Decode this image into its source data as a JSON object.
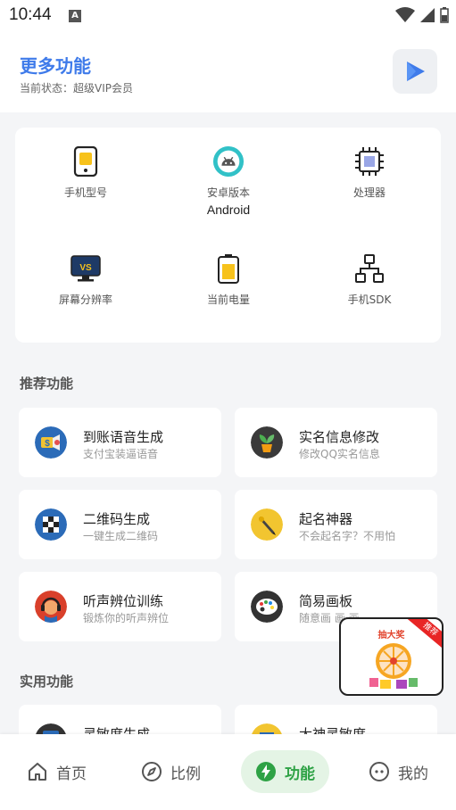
{
  "status_bar": {
    "time": "10:44",
    "notif_icon": "A"
  },
  "header": {
    "title": "更多功能",
    "subtitle": "当前状态：超级VIP会员"
  },
  "device_info": [
    {
      "label": "手机型号",
      "value": "",
      "icon": "phone-icon"
    },
    {
      "label": "安卓版本",
      "value": "Android",
      "icon": "android-icon"
    },
    {
      "label": "处理器",
      "value": "",
      "icon": "cpu-icon"
    },
    {
      "label": "屏幕分辨率",
      "value": "",
      "icon": "monitor-icon"
    },
    {
      "label": "当前电量",
      "value": "",
      "icon": "battery-icon"
    },
    {
      "label": "手机SDK",
      "value": "",
      "icon": "sdk-icon"
    }
  ],
  "recommended": {
    "title": "推荐功能",
    "items": [
      {
        "title": "到账语音生成",
        "sub": "支付宝装逼语音",
        "icon": "speaker-icon"
      },
      {
        "title": "实名信息修改",
        "sub": "修改QQ实名信息",
        "icon": "plant-icon"
      },
      {
        "title": "二维码生成",
        "sub": "一键生成二维码",
        "icon": "qrcode-icon"
      },
      {
        "title": "起名神器",
        "sub": "不会起名字？不用怕",
        "icon": "pen-icon"
      },
      {
        "title": "听声辨位训练",
        "sub": "锻炼你的听声辨位",
        "icon": "headset-icon"
      },
      {
        "title": "简易画板",
        "sub": "随意画 画 画",
        "icon": "palette-icon"
      }
    ]
  },
  "practical": {
    "title": "实用功能",
    "items": [
      {
        "title": "灵敏度生成",
        "icon": "tablet-icon"
      },
      {
        "title": "大神灵敏度",
        "icon": "chart-icon"
      }
    ]
  },
  "lottery": {
    "title": "抽大奖",
    "badge": "推荐"
  },
  "nav": [
    {
      "label": "首页",
      "icon": "home-icon"
    },
    {
      "label": "比例",
      "icon": "compass-icon"
    },
    {
      "label": "功能",
      "icon": "bolt-icon"
    },
    {
      "label": "我的",
      "icon": "face-icon"
    }
  ],
  "colors": {
    "accent": "#3f7bea",
    "nav_active": "#2ea245",
    "nav_active_bg": "#e4f4e5",
    "background": "#f4f5f7"
  }
}
